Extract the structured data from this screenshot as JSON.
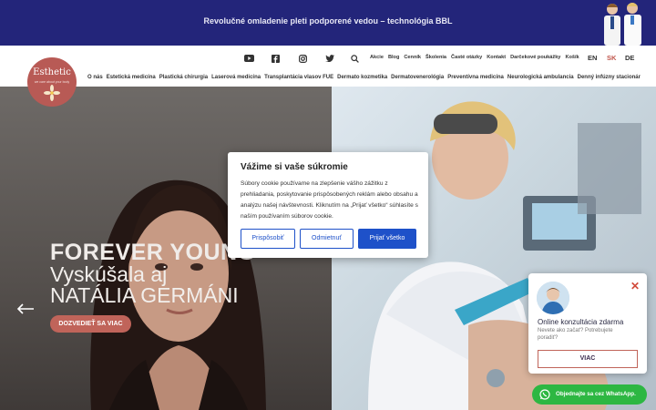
{
  "promo": {
    "text": "Revolučné omladenie pleti podporené vedou – technológia BBL"
  },
  "logo": {
    "name": "Esthetic",
    "sub": "we care about your body"
  },
  "social": [
    "youtube-icon",
    "facebook-icon",
    "instagram-icon",
    "twitter-icon",
    "search-icon"
  ],
  "top_links": [
    "Akcie",
    "Blog",
    "Cenník",
    "Školenia",
    "Časté otázky",
    "Kontakt",
    "Darčekové poukážky",
    "Košík"
  ],
  "languages": [
    {
      "code": "EN",
      "active": false
    },
    {
      "code": "SK",
      "active": true
    },
    {
      "code": "DE",
      "active": false
    }
  ],
  "nav": [
    "O nás",
    "Estetická medicína",
    "Plastická chirurgia",
    "Laserová medicína",
    "Transplantácia vlasov FUE",
    "Dermato kozmetika",
    "Dermatovenerológia",
    "Preventívna medicína",
    "Neurologická ambulancia",
    "Denný infúzny stacionár"
  ],
  "hero": {
    "line1": "FOREVER YOUNG",
    "line2": "Vyskúšala aj",
    "line3": "NATÁLIA GERMÁNI",
    "cta": "DOZVEDIEŤ SA VIAC"
  },
  "cookie": {
    "title": "Vážime si vaše súkromie",
    "body": "Súbory cookie používame na zlepšenie vášho zážitku z prehliadania, poskytovanie prispôsobených reklám alebo obsahu a analýzu našej návštevnosti. Kliknutím na „Prijať všetko“ súhlasíte s naším používaním súborov cookie.",
    "customize": "Prispôsobiť",
    "reject": "Odmietnuť",
    "accept": "Prijať všetko"
  },
  "chat": {
    "title": "Online konzultácia zdarma",
    "subtitle": "Nevete ako začať? Potrebujete poradiť?",
    "button": "VIAC"
  },
  "whatsapp": {
    "text": "Objednajte sa cez WhatsApp."
  },
  "colors": {
    "banner": "#23257a",
    "accent": "#c0645a",
    "cookie_primary": "#1e51c9",
    "whatsapp": "#2db742"
  }
}
